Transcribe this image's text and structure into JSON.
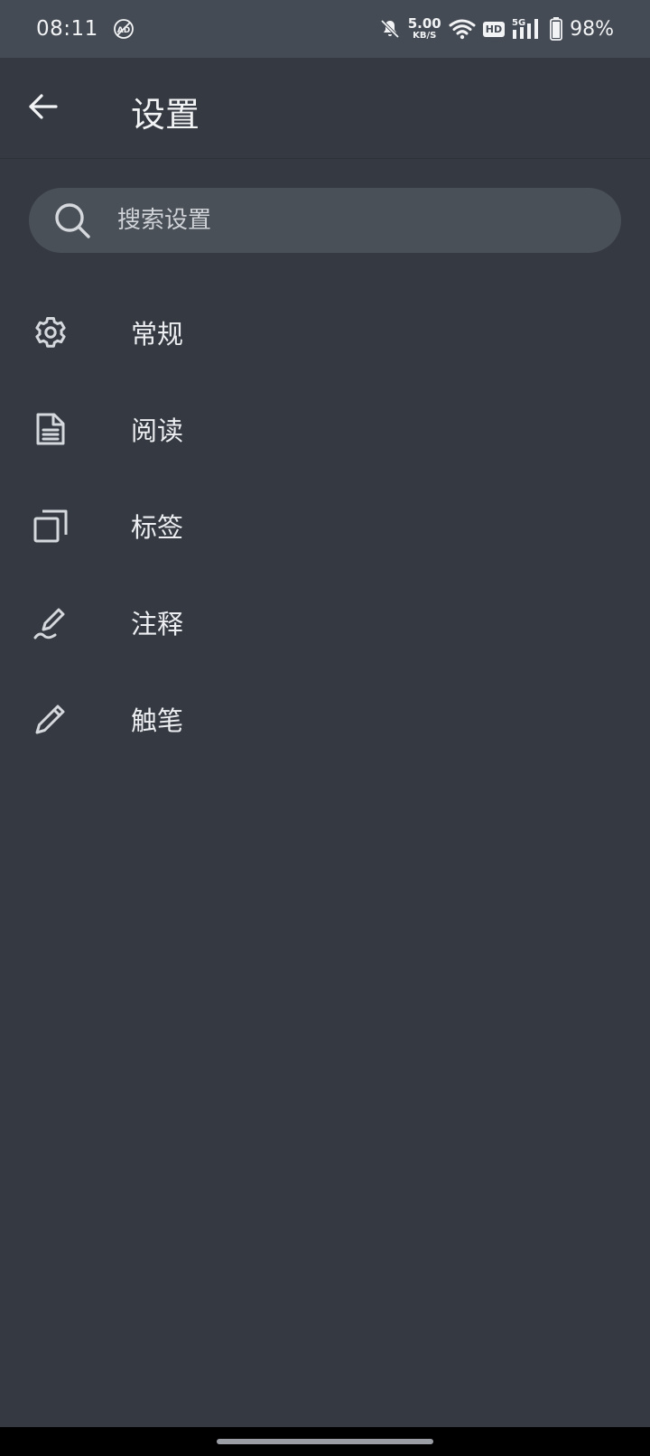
{
  "status_bar": {
    "time": "08:11",
    "net_speed_value": "5.00",
    "net_speed_unit": "KB/S",
    "hd_label": "HD",
    "network_label": "5G",
    "battery": "98%"
  },
  "app_bar": {
    "title": "设置"
  },
  "search": {
    "placeholder": "搜索设置"
  },
  "settings": {
    "items": [
      {
        "label": "常规",
        "icon": "gear-icon"
      },
      {
        "label": "阅读",
        "icon": "document-icon"
      },
      {
        "label": "标签",
        "icon": "tabs-icon"
      },
      {
        "label": "注释",
        "icon": "annotation-pen-icon"
      },
      {
        "label": "触笔",
        "icon": "stylus-pencil-icon"
      }
    ]
  },
  "colors": {
    "background": "#353a42",
    "status_bar": "#454b54",
    "search_field": "#4a5058",
    "text": "#eceef1"
  }
}
